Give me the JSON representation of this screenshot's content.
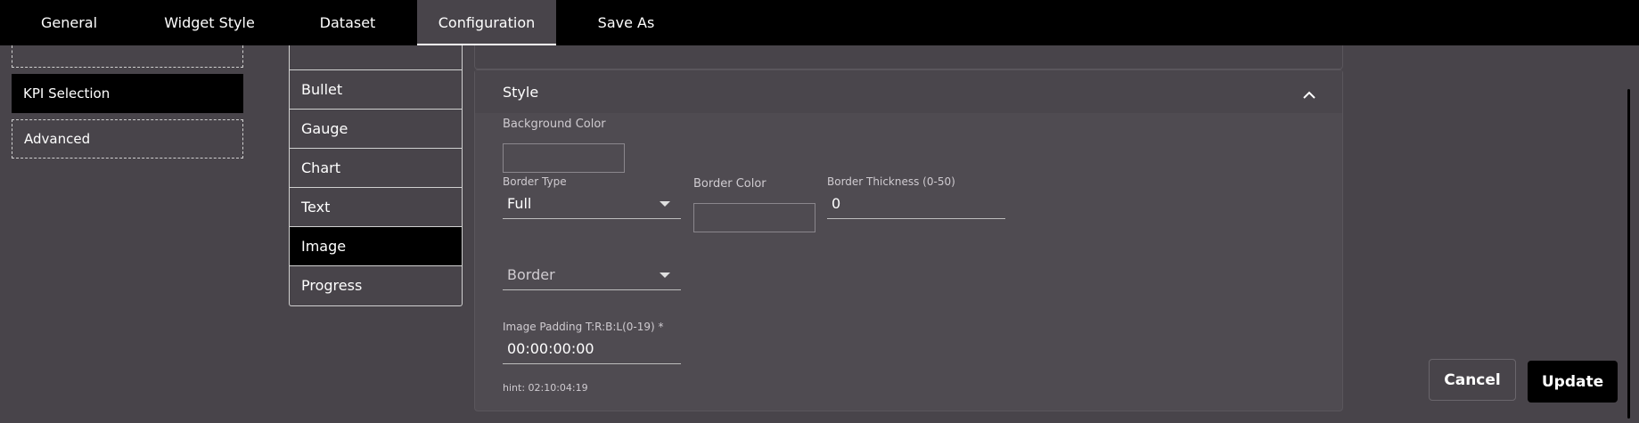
{
  "tabs": [
    {
      "label": "General"
    },
    {
      "label": "Widget Style"
    },
    {
      "label": "Dataset"
    },
    {
      "label": "Configuration"
    },
    {
      "label": "Save As"
    }
  ],
  "sidebar": {
    "items": [
      {
        "label": "KPI Selection"
      },
      {
        "label": "Advanced"
      }
    ]
  },
  "widget_types": [
    {
      "label": "Bullet"
    },
    {
      "label": "Gauge"
    },
    {
      "label": "Chart"
    },
    {
      "label": "Text"
    },
    {
      "label": "Image"
    },
    {
      "label": "Progress"
    }
  ],
  "style_panel": {
    "title": "Style",
    "background_color_label": "Background Color",
    "border_type_label": "Border Type",
    "border_type_value": "Full",
    "border_color_label": "Border Color",
    "border_thickness_label": "Border Thickness (0-50)",
    "border_thickness_value": "0",
    "border_select_placeholder": "Border",
    "image_padding_label": "Image Padding T:R:B:L(0-19) *",
    "image_padding_value": "00:00:00:00",
    "image_padding_hint": "hint: 02:10:04:19"
  },
  "actions": {
    "cancel_label": "Cancel",
    "update_label": "Update"
  },
  "colors": {
    "background": "#48444a",
    "topbar": "#000000",
    "selected": "#000000"
  }
}
